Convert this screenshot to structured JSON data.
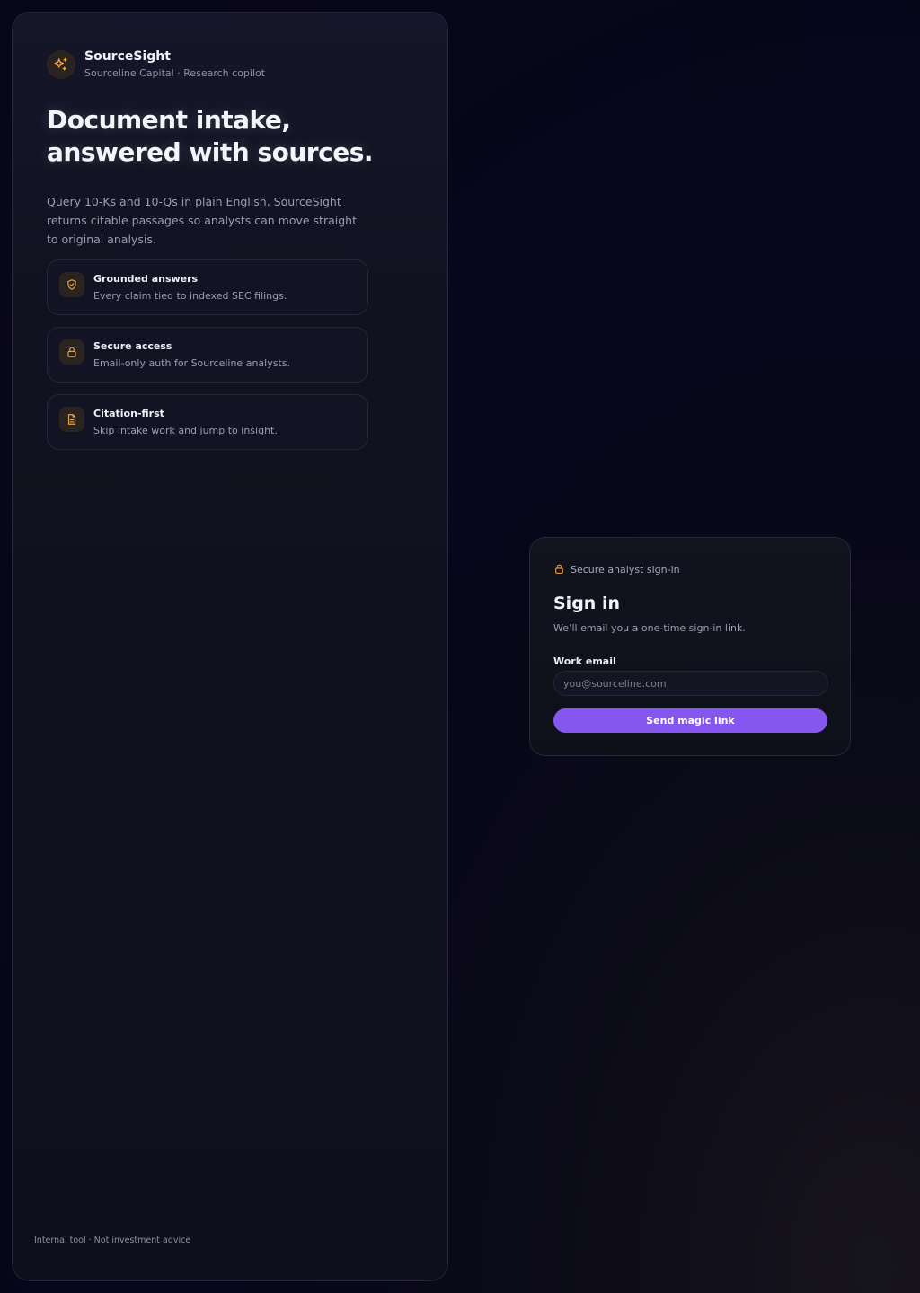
{
  "brand": {
    "name": "SourceSight",
    "subtitle": "Sourceline Capital · Research copilot",
    "icon": "sparkles-icon"
  },
  "hero": {
    "headline": "Document intake, answered with sources.",
    "lead": "Query 10-Ks and 10-Qs in plain English. SourceSight returns citable passages so analysts can move straight to original analysis."
  },
  "features": [
    {
      "icon": "shield-check-icon",
      "title": "Grounded answers",
      "description": "Every claim tied to indexed SEC filings."
    },
    {
      "icon": "lock-icon",
      "title": "Secure access",
      "description": "Email-only auth for Sourceline analysts."
    },
    {
      "icon": "document-icon",
      "title": "Citation-first",
      "description": "Skip intake work and jump to insight."
    }
  ],
  "footer": {
    "note": "Internal tool · Not investment advice"
  },
  "signin": {
    "secure_label": "Secure analyst sign-in",
    "title": "Sign in",
    "subtitle": "We’ll email you a one-time sign-in link.",
    "email_label": "Work email",
    "email_placeholder": "you@sourceline.com",
    "email_value": "",
    "submit_label": "Send magic link"
  },
  "colors": {
    "accent": "#8656f0",
    "icon_orange": "#f2a23a",
    "background": "#080718"
  }
}
